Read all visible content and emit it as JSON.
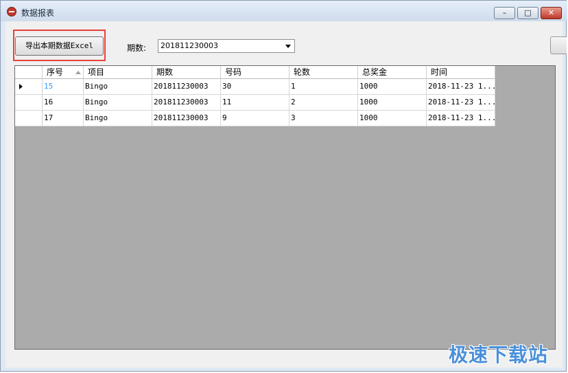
{
  "window": {
    "title": "数据报表",
    "controls": {
      "minimize": "–",
      "maximize": "□",
      "close": "✕"
    }
  },
  "toolbar": {
    "export_label": "导出本期数据Excel",
    "period_label": "期数:",
    "period_value": "201811230003"
  },
  "table": {
    "headers": [
      "序号",
      "项目",
      "期数",
      "号码",
      "轮数",
      "总奖金",
      "时间"
    ],
    "rows": [
      [
        "15",
        "Bingo",
        "201811230003",
        "30",
        "1",
        "1000",
        "2018-11-23 1..."
      ],
      [
        "16",
        "Bingo",
        "201811230003",
        "11",
        "2",
        "1000",
        "2018-11-23 1..."
      ],
      [
        "17",
        "Bingo",
        "201811230003",
        "9",
        "3",
        "1000",
        "2018-11-23 1..."
      ]
    ]
  },
  "watermark": "极速下载站",
  "colors": {
    "highlight": "#e8413b",
    "selected_text": "#3399ff"
  }
}
